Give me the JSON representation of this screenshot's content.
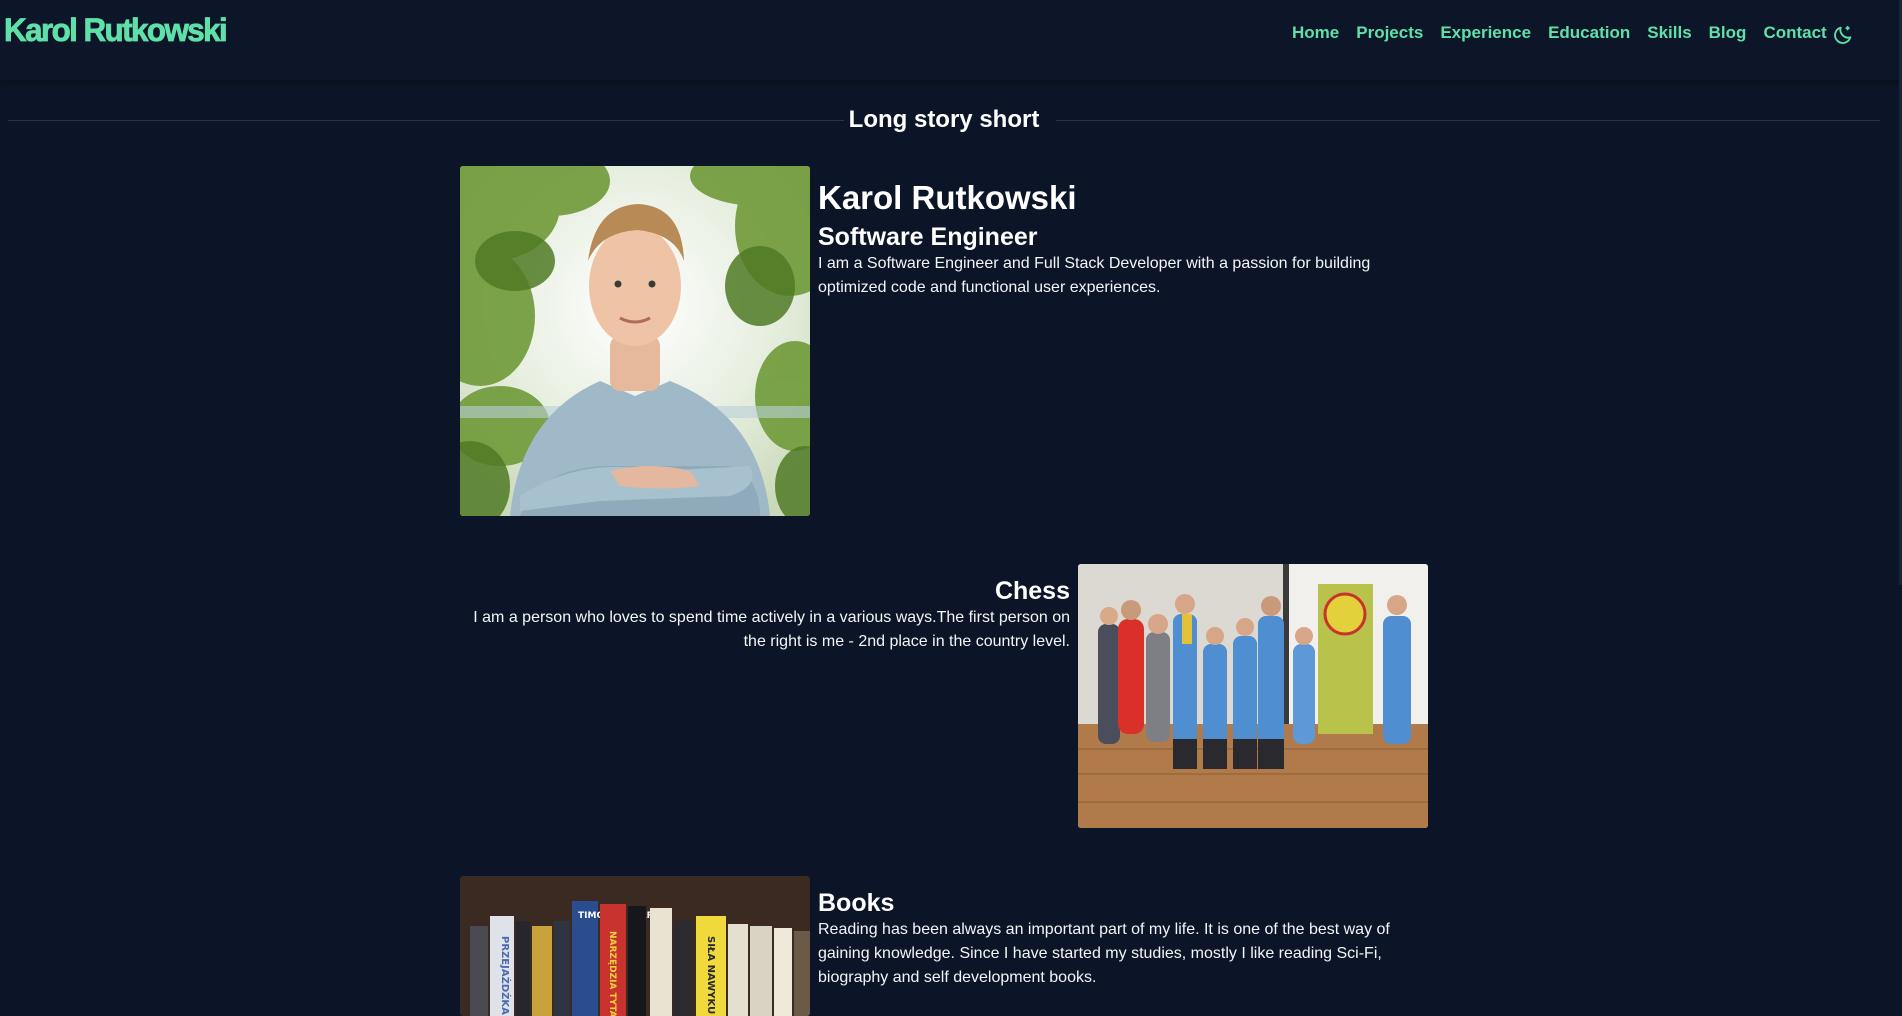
{
  "header": {
    "logo": "Karol Rutkowski",
    "nav": [
      "Home",
      "Projects",
      "Experience",
      "Education",
      "Skills",
      "Blog",
      "Contact"
    ],
    "theme_icon": "moon-sun-icon"
  },
  "section": {
    "title": "Long story short"
  },
  "about": {
    "name": "Karol Rutkowski",
    "role": "Software Engineer",
    "description": "I am a Software Engineer and Full Stack Developer with a passion for building optimized code and functional user experiences."
  },
  "chess": {
    "title": "Chess",
    "description": "I am a person who loves to spend time actively in a various ways.The first person on the right is me - 2nd place in the country level."
  },
  "books": {
    "title": "Books",
    "description": "Reading has been always an important part of my life. It is one of the best way of gaining knowledge. Since I have started my studies, mostly I like reading Sci-Fi, biography and self development books.",
    "visible_spines": [
      "PRZEJAŻDŻKA ŻYCIA",
      "TIMOTHY FERRISS",
      "NARZĘDZIA TYTANÓW",
      "SIŁA NAWYKU"
    ]
  },
  "colors": {
    "background": "#0c1527",
    "accent": "#5fe0a8",
    "text": "#ffffff"
  }
}
